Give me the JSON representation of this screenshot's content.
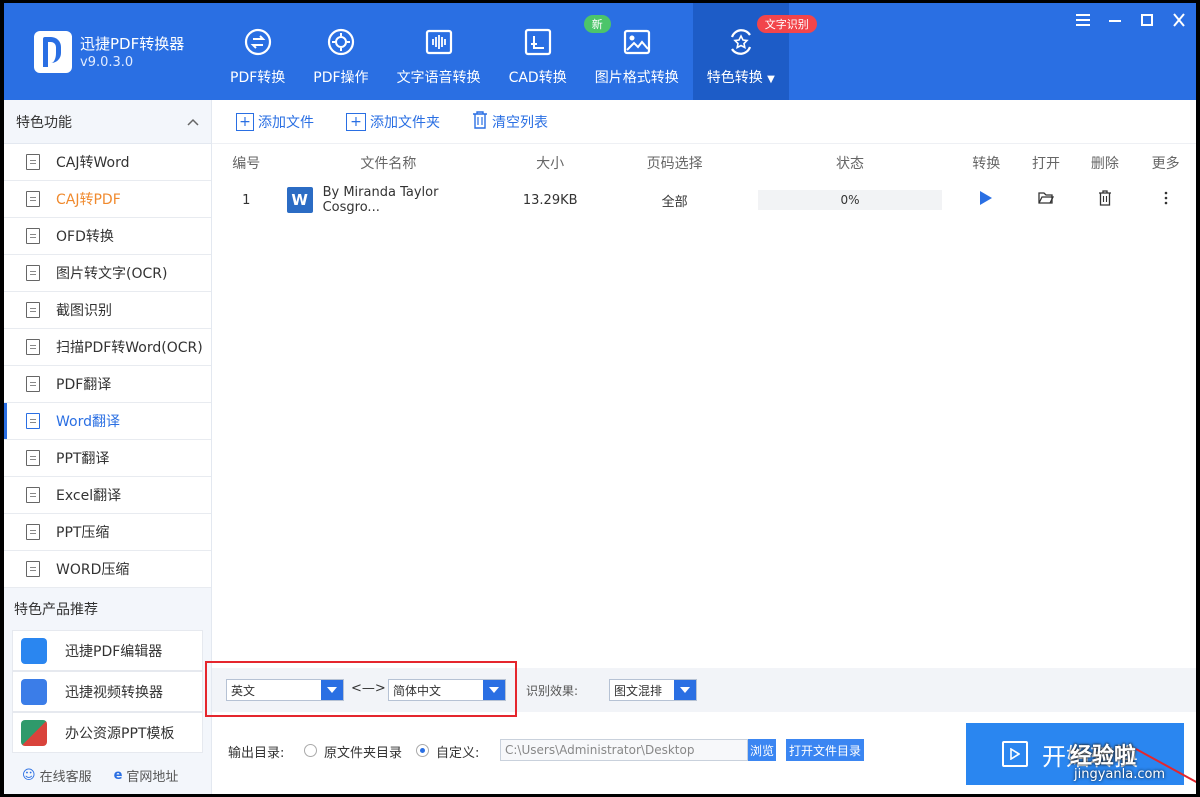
{
  "app": {
    "title": "迅捷PDF转换器",
    "version": "v9.0.3.0"
  },
  "nav": [
    {
      "label": "PDF转换",
      "icon": "pdf-convert-icon"
    },
    {
      "label": "PDF操作",
      "icon": "pdf-operate-icon"
    },
    {
      "label": "文字语音转换",
      "icon": "voice-wave-icon"
    },
    {
      "label": "CAD转换",
      "icon": "cad-icon",
      "badge": ""
    },
    {
      "label": "图片格式转换",
      "icon": "image-icon",
      "badge": "新"
    },
    {
      "label": "特色转换",
      "icon": "star-convert-icon",
      "badge": "文字识别",
      "active": true
    }
  ],
  "sidebar": {
    "header": "特色功能",
    "items": [
      {
        "label": "CAJ转Word",
        "state": "normal"
      },
      {
        "label": "CAJ转PDF",
        "state": "highlight"
      },
      {
        "label": "OFD转换",
        "state": "normal"
      },
      {
        "label": "图片转文字(OCR)",
        "state": "normal"
      },
      {
        "label": "截图识别",
        "state": "normal"
      },
      {
        "label": "扫描PDF转Word(OCR)",
        "state": "normal"
      },
      {
        "label": "PDF翻译",
        "state": "normal"
      },
      {
        "label": "Word翻译",
        "state": "selected"
      },
      {
        "label": "PPT翻译",
        "state": "normal"
      },
      {
        "label": "Excel翻译",
        "state": "normal"
      },
      {
        "label": "PPT压缩",
        "state": "normal"
      },
      {
        "label": "WORD压缩",
        "state": "normal"
      }
    ],
    "products_header": "特色产品推荐",
    "products": [
      {
        "label": "迅捷PDF编辑器",
        "color": "#2a86f0"
      },
      {
        "label": "迅捷视频转换器",
        "color": "#3b7de8"
      },
      {
        "label": "办公资源PPT模板",
        "color": "#2f9a6b"
      }
    ],
    "footer": {
      "service": "在线客服",
      "website": "官网地址"
    }
  },
  "toolbar": {
    "add_file": "添加文件",
    "add_folder": "添加文件夹",
    "clear_list": "清空列表"
  },
  "table": {
    "headers": [
      "编号",
      "文件名称",
      "大小",
      "页码选择",
      "状态",
      "转换",
      "打开",
      "删除",
      "更多"
    ],
    "rows": [
      {
        "no": "1",
        "name": "By Miranda Taylor Cosgro...",
        "size": "13.29KB",
        "pages": "全部",
        "status": "0%"
      }
    ]
  },
  "language": {
    "from": "英文",
    "swap": "<—>",
    "to": "简体中文",
    "effect_label": "识别效果:",
    "effect_value": "图文混排"
  },
  "output": {
    "label": "输出目录:",
    "option_source": "原文件夹目录",
    "option_custom": "自定义:",
    "path": "C:\\Users\\Administrator\\Desktop",
    "browse": "浏览",
    "open_dir": "打开文件目录"
  },
  "start_button": "开始转换",
  "watermark": {
    "main": "经验啦",
    "sub": "jingyanla.com"
  },
  "colors": {
    "primary": "#2a6fe3",
    "accent_orange": "#f08a2e",
    "annotation_red": "#e5262d"
  }
}
